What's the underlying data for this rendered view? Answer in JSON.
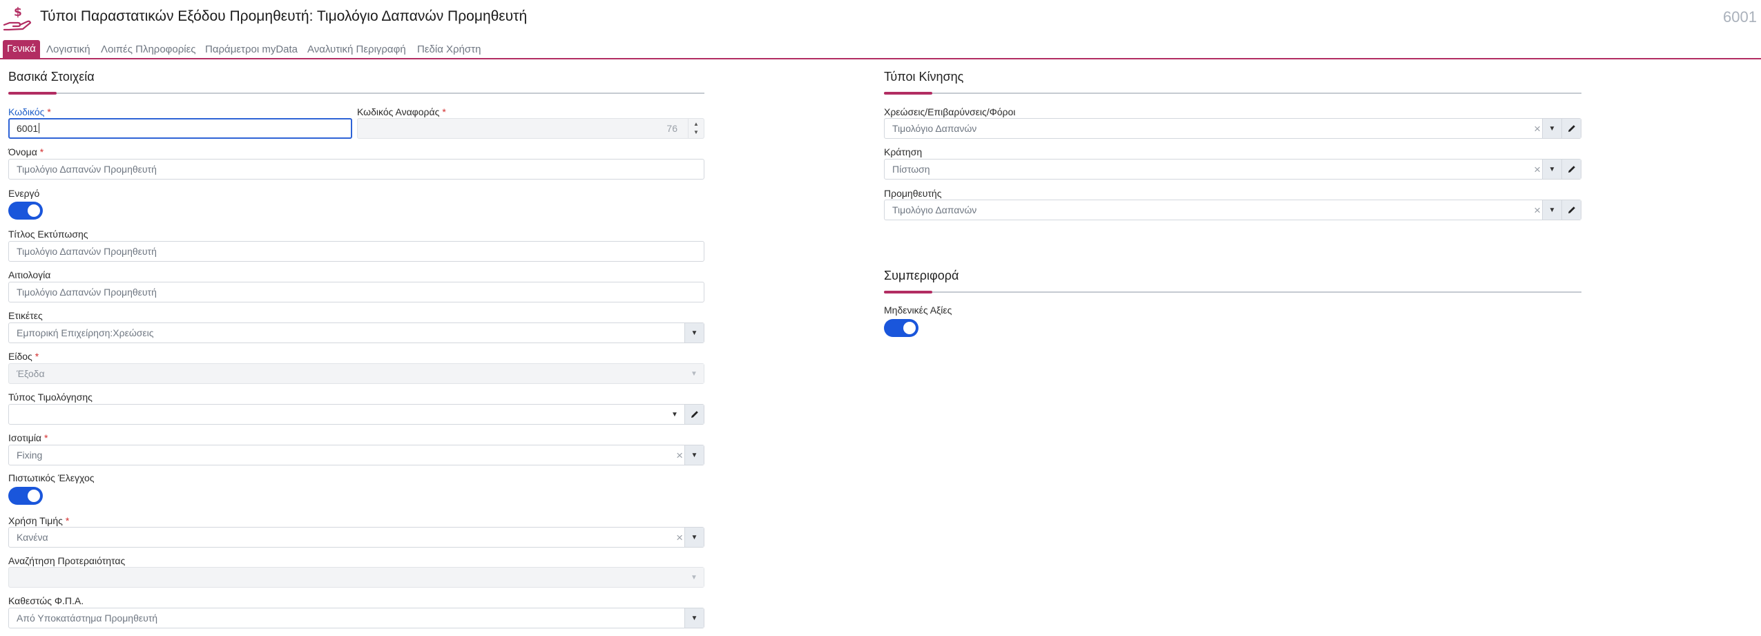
{
  "header": {
    "title": "Τύποι Παραστατικών Εξόδου Προμηθευτή: Τιμολόγιο Δαπανών Προμηθευτή",
    "record_code": "6001"
  },
  "tabs": [
    {
      "label": "Γενικά",
      "active": true
    },
    {
      "label": "Λογιστική"
    },
    {
      "label": "Λοιπές Πληροφορίες"
    },
    {
      "label": "Παράμετροι myData"
    },
    {
      "label": "Αναλυτική Περιγραφή"
    },
    {
      "label": "Πεδία Χρήστη"
    }
  ],
  "basic": {
    "title": "Βασικά Στοιχεία",
    "code": {
      "label": "Κωδικός",
      "required": "*",
      "value": "6001"
    },
    "ref_code": {
      "label": "Κωδικός Αναφοράς",
      "required": "*",
      "value": "76"
    },
    "name": {
      "label": "Όνομα",
      "required": "*",
      "value": "Τιμολόγιο Δαπανών Προμηθευτή"
    },
    "active": {
      "label": "Ενεργό",
      "on": true
    },
    "print_title": {
      "label": "Τίτλος Εκτύπωσης",
      "value": "Τιμολόγιο Δαπανών Προμηθευτή"
    },
    "reason": {
      "label": "Αιτιολογία",
      "value": "Τιμολόγιο Δαπανών Προμηθευτή"
    },
    "tags": {
      "label": "Ετικέτες",
      "value": "Εμπορική Επιχείρηση:Χρεώσεις"
    },
    "kind": {
      "label": "Είδος",
      "required": "*",
      "value": "Έξοδα"
    },
    "invoice_type": {
      "label": "Τύπος Τιμολόγησης",
      "value": ""
    },
    "parity": {
      "label": "Ισοτιμία",
      "required": "*",
      "value": "Fixing"
    },
    "credit_check": {
      "label": "Πιστωτικός Έλεγχος",
      "on": true
    },
    "price_use": {
      "label": "Χρήση Τιμής",
      "required": "*",
      "value": "Κανένα"
    },
    "priority_search": {
      "label": "Αναζήτηση Προτεραιότητας",
      "value": ""
    },
    "vat_status": {
      "label": "Καθεστώς Φ.Π.Α.",
      "value": "Από Υποκατάστημα Προμηθευτή"
    }
  },
  "movement": {
    "title": "Τύποι Κίνησης",
    "charges": {
      "label": "Χρεώσεις/Επιβαρύνσεις/Φόροι",
      "value": "Τιμολόγιο Δαπανών"
    },
    "hold": {
      "label": "Κράτηση",
      "value": "Πίστωση"
    },
    "supplier": {
      "label": "Προμηθευτής",
      "value": "Τιμολόγιο Δαπανών"
    }
  },
  "behavior": {
    "title": "Συμπεριφορά",
    "zero_values": {
      "label": "Μηδενικές Αξίες",
      "on": true
    }
  },
  "colors": {
    "accent": "#b22d62",
    "toggle_on": "#1a56db",
    "focus": "#2e63d6"
  },
  "icons": {
    "clear": "×",
    "caret": "▼",
    "spin_up": "▲",
    "spin_down": "▼"
  }
}
